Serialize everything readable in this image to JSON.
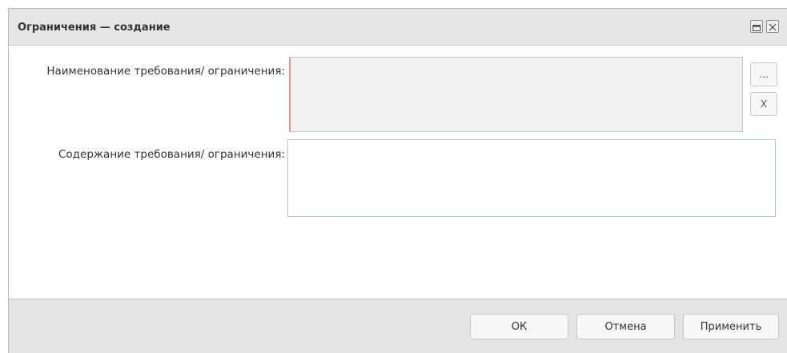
{
  "window": {
    "title": "Ограничения — создание",
    "maximize_icon": "maximize-icon",
    "close_icon": "close-icon"
  },
  "form": {
    "name_label": "Наименование требования/ ограничения:",
    "name_value": "",
    "content_label": "Содержание требования/ ограничения:",
    "content_value": "",
    "select_button_label": "...",
    "clear_button_label": "X"
  },
  "footer": {
    "ok_label": "ОК",
    "cancel_label": "Отмена",
    "apply_label": "Применить"
  },
  "colors": {
    "required_marker": "#e59595",
    "title_bar": "#e6e6e6",
    "readonly_field": "#f1f1f1"
  }
}
